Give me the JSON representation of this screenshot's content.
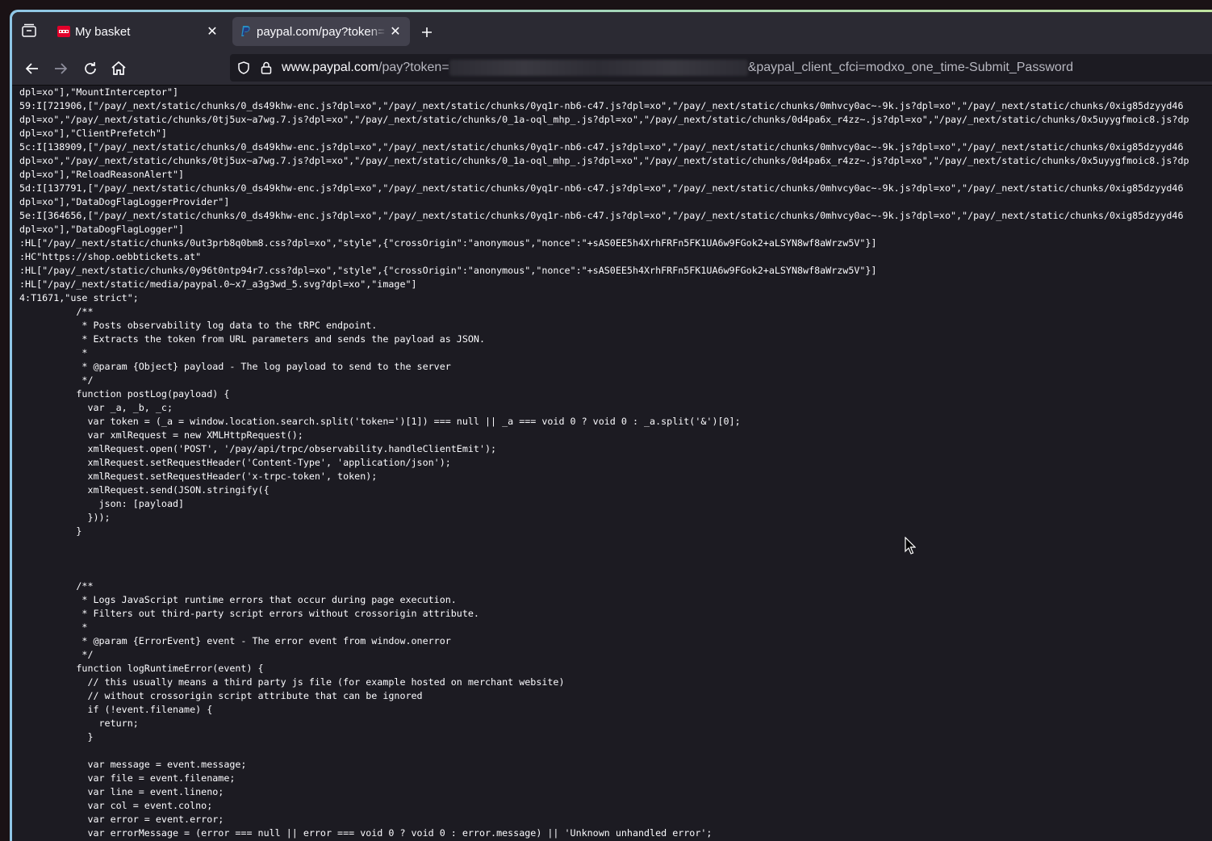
{
  "browser": {
    "tabs": [
      {
        "title": "My basket",
        "active": false,
        "favicon": "oebb-logo"
      },
      {
        "title": "paypal.com/pay?token=",
        "active": true,
        "favicon": "paypal-logo"
      }
    ],
    "url": {
      "host": "www.paypal.com",
      "path_prefix": "/pay?token=",
      "suffix": "&paypal_client_cfci=modxo_one_time-Submit_Password"
    },
    "icons": {
      "tab_overview": "tab-overview-icon",
      "new_tab": "plus-icon",
      "back": "back-arrow-icon",
      "forward": "forward-arrow-icon",
      "reload": "reload-icon",
      "home": "home-icon",
      "shield": "shield-icon",
      "lock": "lock-icon"
    }
  },
  "source_lines": [
    "dpl=xo\"],\"MountInterceptor\"]",
    "59:I[721906,[\"/pay/_next/static/chunks/0_ds49khw-enc.js?dpl=xo\",\"/pay/_next/static/chunks/0yq1r-nb6-c47.js?dpl=xo\",\"/pay/_next/static/chunks/0mhvcy0ac~-9k.js?dpl=xo\",\"/pay/_next/static/chunks/0xig85dzyyd46",
    "dpl=xo\",\"/pay/_next/static/chunks/0tj5ux~a7wg.7.js?dpl=xo\",\"/pay/_next/static/chunks/0_1a-oql_mhp_.js?dpl=xo\",\"/pay/_next/static/chunks/0d4pa6x_r4zz~.js?dpl=xo\",\"/pay/_next/static/chunks/0x5uyygfmoic8.js?dp",
    "dpl=xo\"],\"ClientPrefetch\"]",
    "5c:I[138909,[\"/pay/_next/static/chunks/0_ds49khw-enc.js?dpl=xo\",\"/pay/_next/static/chunks/0yq1r-nb6-c47.js?dpl=xo\",\"/pay/_next/static/chunks/0mhvcy0ac~-9k.js?dpl=xo\",\"/pay/_next/static/chunks/0xig85dzyyd46",
    "dpl=xo\",\"/pay/_next/static/chunks/0tj5ux~a7wg.7.js?dpl=xo\",\"/pay/_next/static/chunks/0_1a-oql_mhp_.js?dpl=xo\",\"/pay/_next/static/chunks/0d4pa6x_r4zz~.js?dpl=xo\",\"/pay/_next/static/chunks/0x5uyygfmoic8.js?dp",
    "dpl=xo\"],\"ReloadReasonAlert\"]",
    "5d:I[137791,[\"/pay/_next/static/chunks/0_ds49khw-enc.js?dpl=xo\",\"/pay/_next/static/chunks/0yq1r-nb6-c47.js?dpl=xo\",\"/pay/_next/static/chunks/0mhvcy0ac~-9k.js?dpl=xo\",\"/pay/_next/static/chunks/0xig85dzyyd46",
    "dpl=xo\"],\"DataDogFlagLoggerProvider\"]",
    "5e:I[364656,[\"/pay/_next/static/chunks/0_ds49khw-enc.js?dpl=xo\",\"/pay/_next/static/chunks/0yq1r-nb6-c47.js?dpl=xo\",\"/pay/_next/static/chunks/0mhvcy0ac~-9k.js?dpl=xo\",\"/pay/_next/static/chunks/0xig85dzyyd46",
    "dpl=xo\"],\"DataDogFlagLogger\"]",
    ":HL[\"/pay/_next/static/chunks/0ut3prb8q0bm8.css?dpl=xo\",\"style\",{\"crossOrigin\":\"anonymous\",\"nonce\":\"+sAS0EE5h4XrhFRFn5FK1UA6w9FGok2+aLSYN8wf8aWrzw5V\"}]",
    ":HC\"https://shop.oebbtickets.at\"",
    ":HL[\"/pay/_next/static/chunks/0y96t0ntp94r7.css?dpl=xo\",\"style\",{\"crossOrigin\":\"anonymous\",\"nonce\":\"+sAS0EE5h4XrhFRFn5FK1UA6w9FGok2+aLSYN8wf8aWrzw5V\"}]",
    ":HL[\"/pay/_next/static/media/paypal.0~x7_a3g3wd_5.svg?dpl=xo\",\"image\"]",
    "4:T1671,\"use strict\";",
    "          /**",
    "           * Posts observability log data to the tRPC endpoint.",
    "           * Extracts the token from URL parameters and sends the payload as JSON.",
    "           *",
    "           * @param {Object} payload - The log payload to send to the server",
    "           */",
    "          function postLog(payload) {",
    "            var _a, _b, _c;",
    "            var token = (_a = window.location.search.split('token=')[1]) === null || _a === void 0 ? void 0 : _a.split('&')[0];",
    "            var xmlRequest = new XMLHttpRequest();",
    "            xmlRequest.open('POST', '/pay/api/trpc/observability.handleClientEmit');",
    "            xmlRequest.setRequestHeader('Content-Type', 'application/json');",
    "            xmlRequest.setRequestHeader('x-trpc-token', token);",
    "            xmlRequest.send(JSON.stringify({",
    "              json: [payload]",
    "            }));",
    "          }",
    "",
    "",
    "",
    "          /**",
    "           * Logs JavaScript runtime errors that occur during page execution.",
    "           * Filters out third-party script errors without crossorigin attribute.",
    "           *",
    "           * @param {ErrorEvent} event - The error event from window.onerror",
    "           */",
    "          function logRuntimeError(event) {",
    "            // this usually means a third party js file (for example hosted on merchant website)",
    "            // without crossorigin script attribute that can be ignored",
    "            if (!event.filename) {",
    "              return;",
    "            }",
    "",
    "            var message = event.message;",
    "            var file = event.filename;",
    "            var line = event.lineno;",
    "            var col = event.colno;",
    "            var error = event.error;",
    "            var errorMessage = (error === null || error === void 0 ? void 0 : error.message) || 'Unknown unhandled error';"
  ]
}
